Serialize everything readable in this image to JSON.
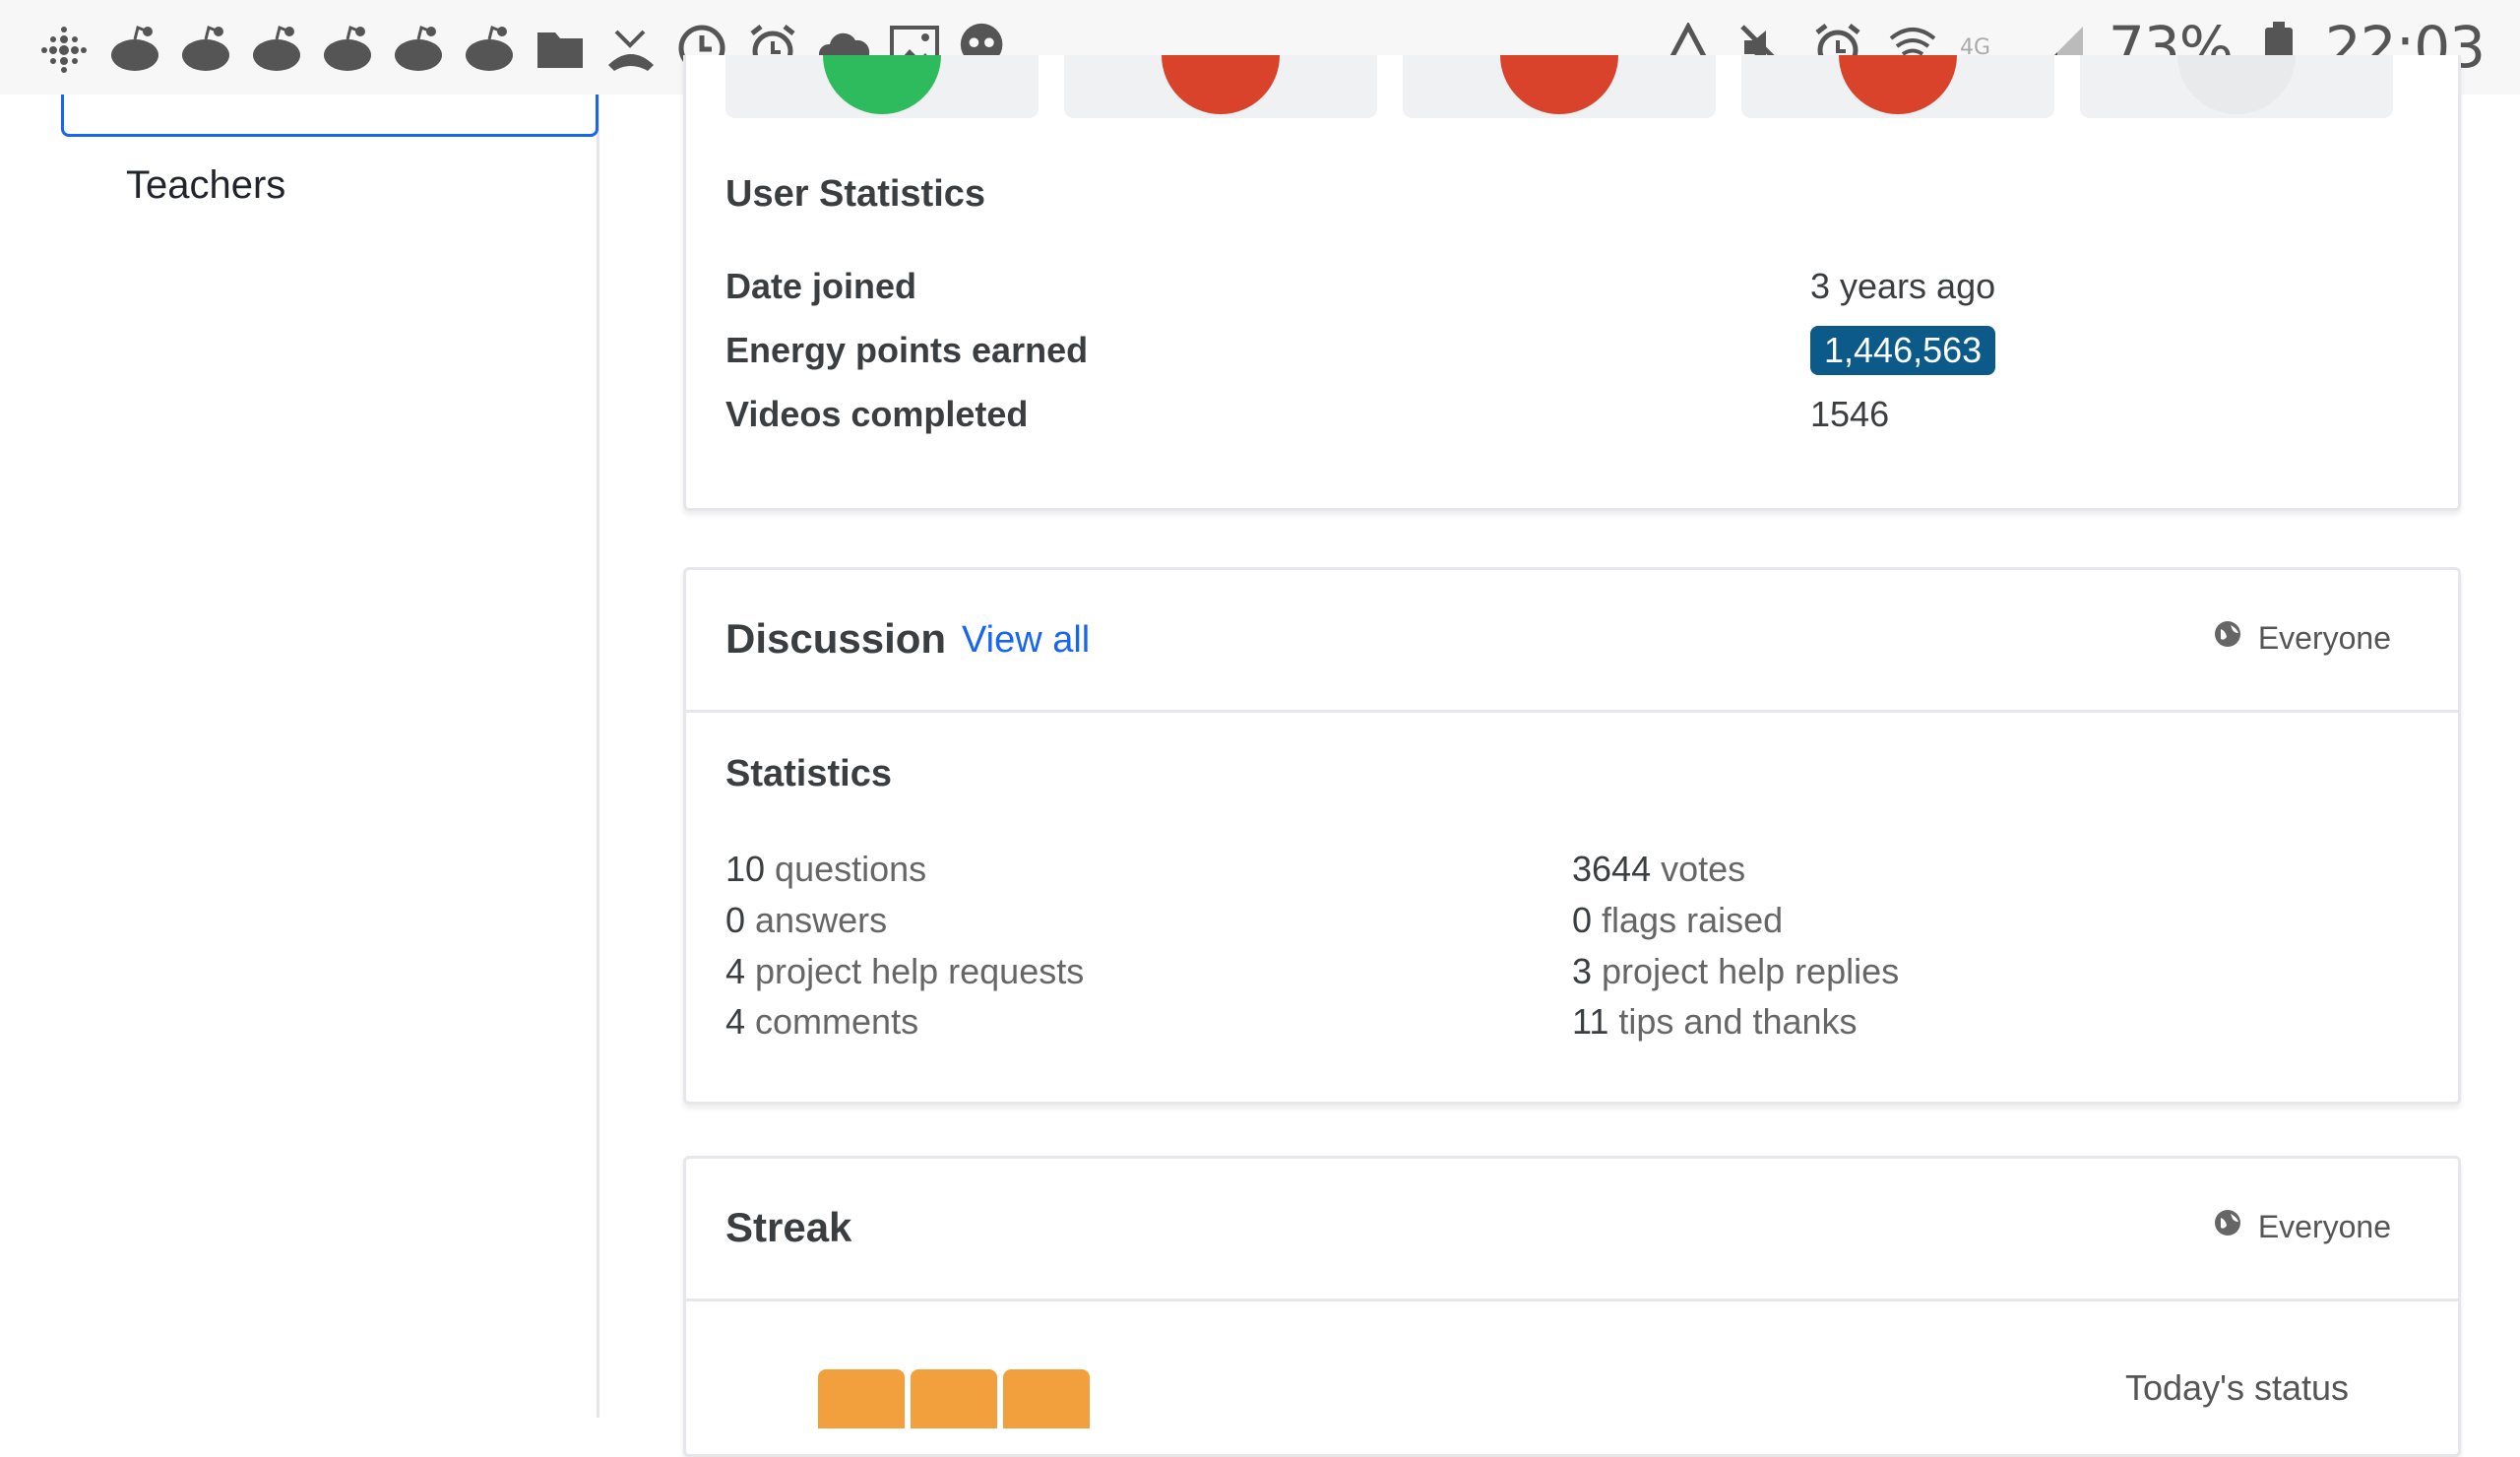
{
  "status_bar": {
    "left_icons": [
      "fitbit-icon",
      "reddit-icon",
      "reddit-icon",
      "reddit-icon",
      "reddit-icon",
      "reddit-icon",
      "reddit-icon",
      "folder-icon",
      "missed-call-icon",
      "clock-icon",
      "alarm-icon",
      "cloud-icon",
      "image-icon",
      "game-icon"
    ],
    "battery_percent": "73%",
    "time": "22:03"
  },
  "sidebar": {
    "items": [
      {
        "label": "Teachers"
      }
    ]
  },
  "user_statistics": {
    "title": "User Statistics",
    "rows": [
      {
        "label": "Date joined",
        "value": "3 years ago"
      },
      {
        "label": "Energy points earned",
        "value": "1,446,563"
      },
      {
        "label": "Videos completed",
        "value": "1546"
      }
    ]
  },
  "discussion": {
    "title": "Discussion",
    "view_all": "View all",
    "visibility": "Everyone",
    "stats_title": "Statistics",
    "left": [
      {
        "num": "10",
        "text": " questions"
      },
      {
        "num": "0",
        "text": " answers"
      },
      {
        "num": "4",
        "text": " project help requests"
      },
      {
        "num": "4",
        "text": " comments"
      }
    ],
    "right": [
      {
        "num": "3644",
        "text": " votes"
      },
      {
        "num": "0",
        "text": " flags raised"
      },
      {
        "num": "3",
        "text": " project help replies"
      },
      {
        "num": "11",
        "text": " tips and thanks"
      }
    ]
  },
  "streak": {
    "title": "Streak",
    "visibility": "Everyone",
    "today_status": "Today's status"
  },
  "colors": {
    "accent": "#1865f2",
    "energy_pill": "#0b5a8a",
    "streak": "#f2a03d",
    "badge_green": "#2dbb5d",
    "badge_red": "#d9432b"
  }
}
